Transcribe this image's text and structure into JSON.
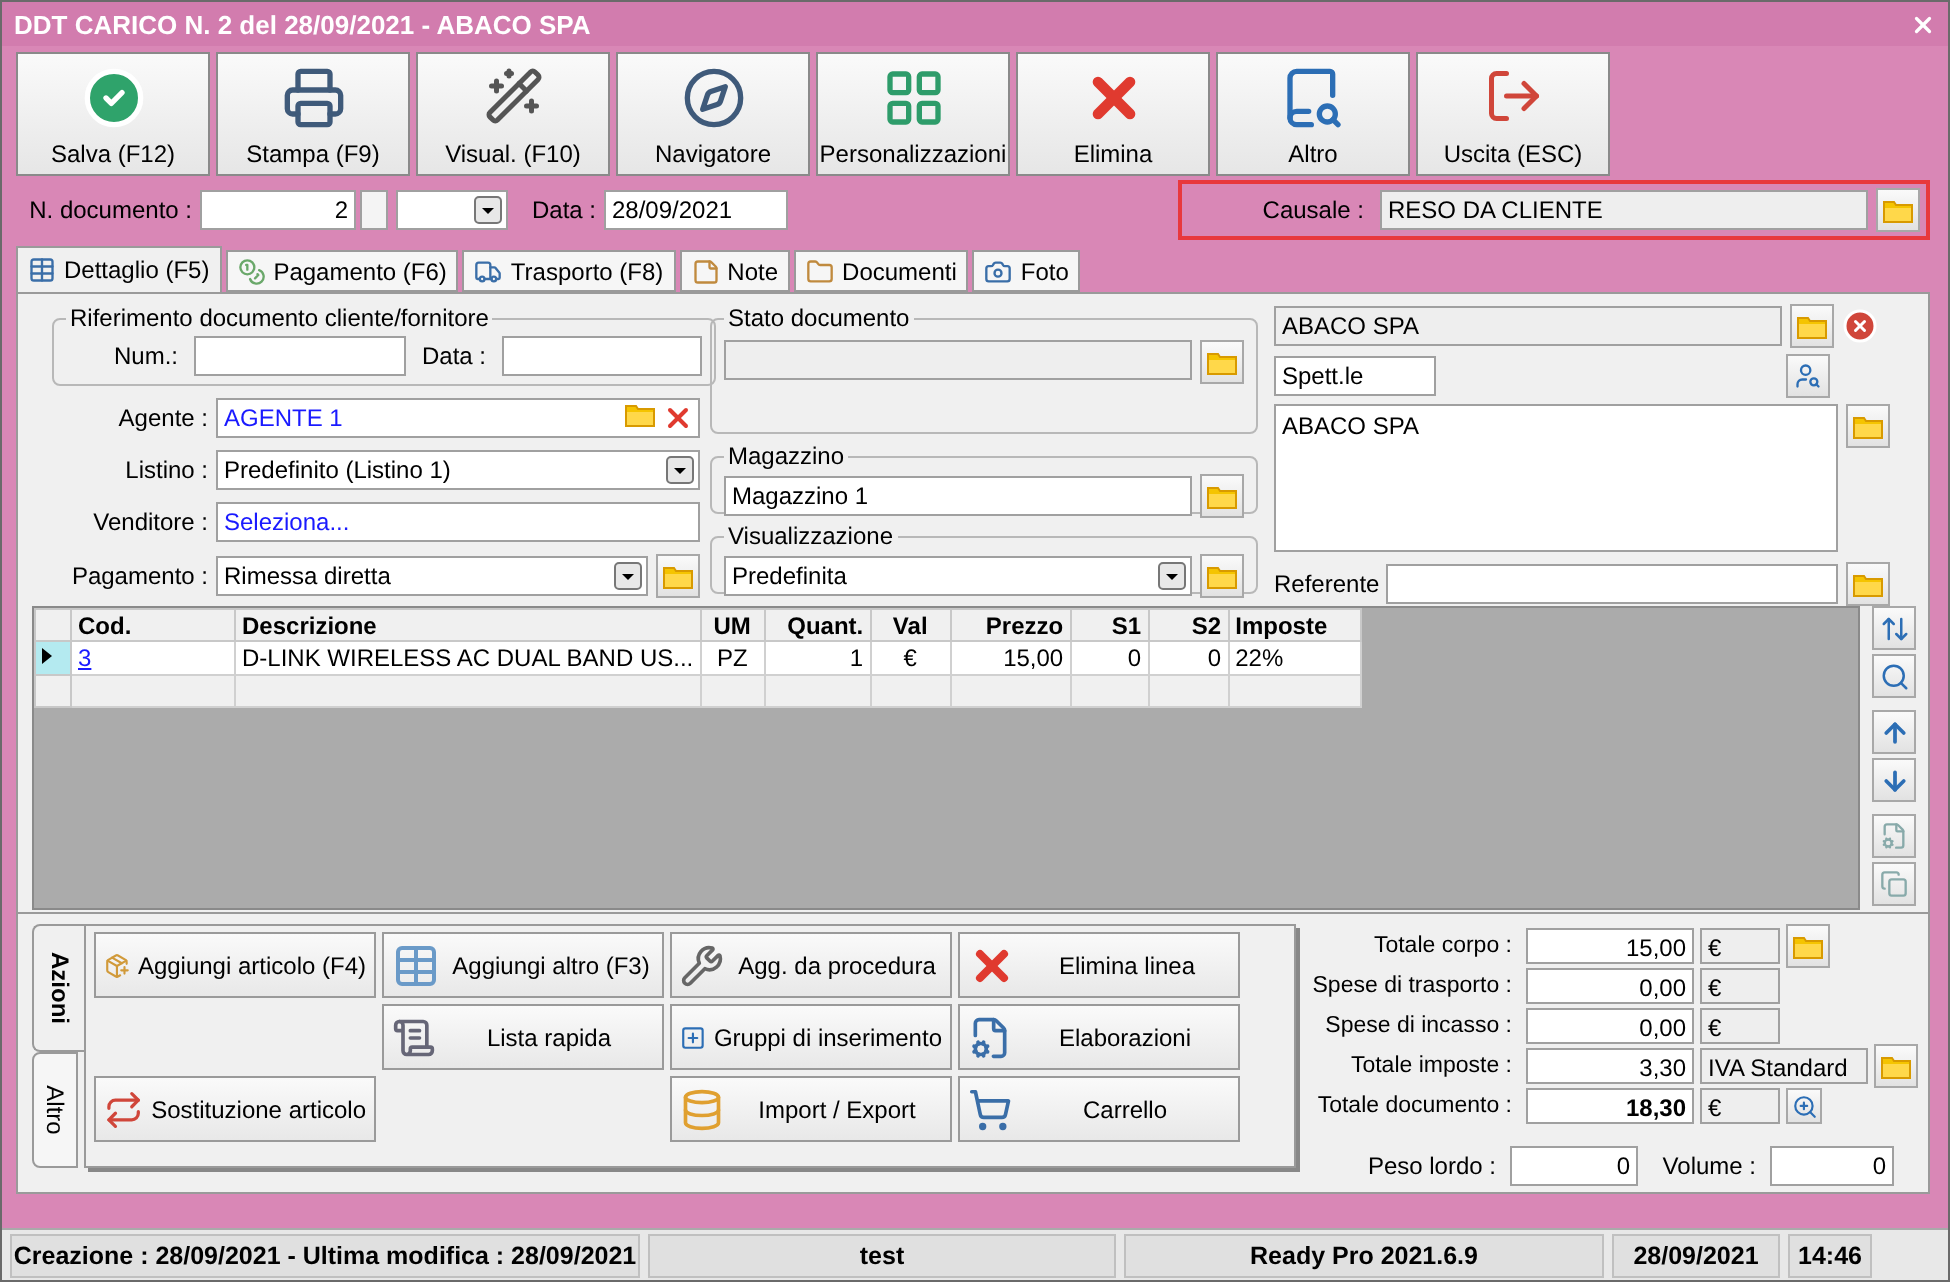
{
  "window": {
    "title": "DDT CARICO N. 2 del 28/09/2021 - ABACO SPA"
  },
  "toolbar": [
    {
      "label": "Salva (F12)"
    },
    {
      "label": "Stampa (F9)"
    },
    {
      "label": "Visual. (F10)"
    },
    {
      "label": "Navigatore"
    },
    {
      "label": "Personalizzazioni"
    },
    {
      "label": "Elimina"
    },
    {
      "label": "Altro"
    },
    {
      "label": "Uscita (ESC)"
    }
  ],
  "header": {
    "doc_number": {
      "label": "N. documento :",
      "value": "2"
    },
    "date": {
      "label": "Data :",
      "value": "28/09/2021"
    },
    "causale": {
      "label": "Causale :",
      "value": "RESO DA CLIENTE",
      "highlighted": true
    }
  },
  "tabs": [
    {
      "label": "Dettaglio (F5)",
      "selected": true
    },
    {
      "label": "Pagamento (F6)",
      "selected": false
    },
    {
      "label": "Trasporto (F8)",
      "selected": false
    },
    {
      "label": "Note",
      "selected": false
    },
    {
      "label": "Documenti",
      "selected": false
    },
    {
      "label": "Foto",
      "selected": false
    }
  ],
  "reference": {
    "title": "Riferimento documento cliente/fornitore",
    "num_label": "Num.:",
    "date_label": "Data :"
  },
  "agente": {
    "label": "Agente :",
    "value": "AGENTE 1"
  },
  "listino": {
    "label": "Listino :",
    "value": "Predefinito (Listino 1)"
  },
  "venditore": {
    "label": "Venditore :",
    "value": "Seleziona..."
  },
  "pagamento": {
    "label": "Pagamento :",
    "value": "Rimessa diretta"
  },
  "stato_documento": {
    "title": "Stato documento"
  },
  "magazzino": {
    "title": "Magazzino",
    "value": "Magazzino 1"
  },
  "visualizzazione": {
    "title": "Visualizzazione",
    "value": "Predefinita"
  },
  "customer": {
    "name": "ABACO SPA",
    "salutation": "Spett.le",
    "address": "ABACO SPA",
    "referente_label": "Referente"
  },
  "table": {
    "columns": [
      "Cod.",
      "Descrizione",
      "UM",
      "Quant.",
      "Val",
      "Prezzo",
      "S1",
      "S2",
      "Imposte"
    ],
    "rows": [
      {
        "selected": true,
        "cells": [
          "3",
          "D-LINK WIRELESS AC DUAL BAND US...",
          "PZ",
          "1",
          "€",
          "15,00",
          "0",
          "0",
          "22%"
        ]
      }
    ]
  },
  "action_tabs": [
    {
      "label": "Azioni",
      "selected": true
    },
    {
      "label": "Altro",
      "selected": false
    }
  ],
  "actions": [
    "Aggiungi articolo (F4)",
    "Aggiungi altro (F3)",
    "Agg. da procedura",
    "Elimina linea",
    "Lista rapida",
    "Gruppi di inserimento",
    "Elaborazioni",
    "Sostituzione articolo",
    "Import / Export",
    "Carrello"
  ],
  "totals": [
    {
      "label": "Totale corpo :",
      "value": "15,00",
      "unit": "€",
      "kind": "folder",
      "bold": false
    },
    {
      "label": "Spese di trasporto :",
      "value": "0,00",
      "unit": "€",
      "kind": "plain",
      "bold": false
    },
    {
      "label": "Spese di incasso :",
      "value": "0,00",
      "unit": "€",
      "kind": "plain",
      "bold": false
    },
    {
      "label": "Totale imposte :",
      "value": "3,30",
      "unit": "IVA Standard",
      "kind": "folder",
      "bold": false
    },
    {
      "label": "Totale documento :",
      "value": "18,30",
      "unit": "€",
      "kind": "zoom",
      "bold": true
    }
  ],
  "weights": [
    {
      "label": "Peso lordo :",
      "value": "0"
    },
    {
      "label": "Volume :",
      "value": "0"
    }
  ],
  "status_bar": [
    "Creazione : 28/09/2021 - Ultima modifica : 28/09/2021",
    "test",
    "Ready Pro 2021.6.9",
    "28/09/2021",
    "14:46"
  ]
}
